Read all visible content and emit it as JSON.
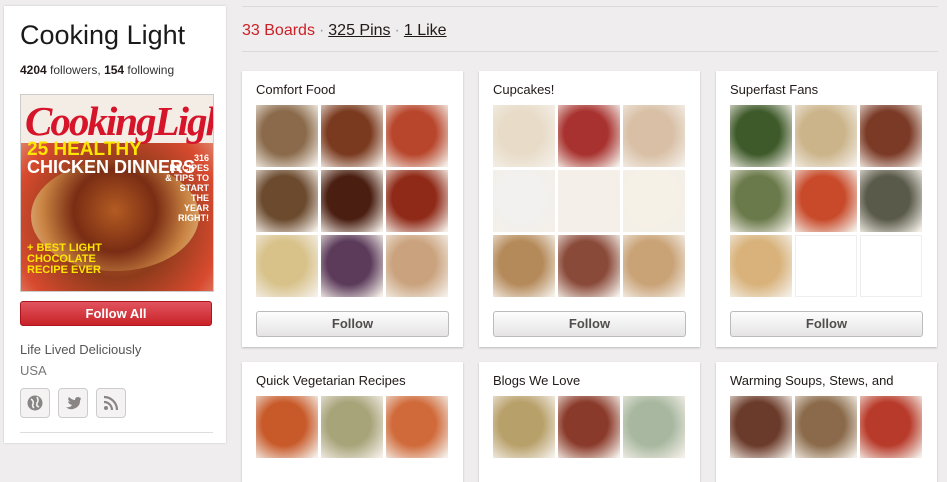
{
  "profile": {
    "name": "Cooking Light",
    "followers_count": "4204",
    "followers_label": " followers, ",
    "following_count": "154",
    "following_label": " following",
    "follow_all_label": "Follow All",
    "about": "Life Lived Deliciously",
    "location": "USA",
    "magazine": {
      "masthead": "CookingLight",
      "headline_1": "25 HEALTHY",
      "headline_2": "CHICKEN DINNERS",
      "subhead": "+ BEST LIGHT CHOCOLATE RECIPE EVER",
      "badge": "316 RECIPES & TIPS TO START THE YEAR RIGHT!"
    },
    "social": [
      {
        "icon": "globe-icon"
      },
      {
        "icon": "twitter-icon"
      },
      {
        "icon": "rss-icon"
      }
    ]
  },
  "tabs": {
    "boards": "33 Boards",
    "pins": "325 Pins",
    "likes": "1 Like",
    "separator": "·"
  },
  "colors": {
    "accent": "#cb2027",
    "background": "#efeded"
  },
  "boards": [
    {
      "title": "Comfort Food",
      "follow_label": "Follow",
      "thumbs": [
        "#8a6a4a",
        "#7a3a1f",
        "#b8462c",
        "#6b4a2e",
        "#4a1f12",
        "#8f2a18",
        "#d8c28a",
        "#5b3a5a",
        "#caa37e"
      ]
    },
    {
      "title": "Cupcakes!",
      "follow_label": "Follow",
      "thumbs": [
        "#e8dcc8",
        "#a8322f",
        "#d8bfa5",
        "#f2f1ef",
        "#f4efe8",
        "#f6f1e6",
        "#b58a5a",
        "#8a4a3a",
        "#c9a276"
      ]
    },
    {
      "title": "Superfast Fans",
      "follow_label": "Follow",
      "thumbs": [
        "#3e5a2a",
        "#cbb48a",
        "#7a3a26",
        "#6a7a4a",
        "#c84a2a",
        "#5a5a4a",
        "#d8b27a",
        "",
        ""
      ]
    },
    {
      "title": "Quick Vegetarian Recipes",
      "follow_label": "Follow",
      "thumbs": [
        "#c85a2a",
        "#a8a47a",
        "#d06a3a"
      ]
    },
    {
      "title": "Blogs We Love",
      "follow_label": "Follow",
      "thumbs": [
        "#b8a06a",
        "#8a3a2a",
        "#a8b8a0"
      ]
    },
    {
      "title": "Warming Soups, Stews, and",
      "follow_label": "Follow",
      "thumbs": [
        "#6a3a2a",
        "#8a6a4a",
        "#b83a2a"
      ]
    }
  ]
}
